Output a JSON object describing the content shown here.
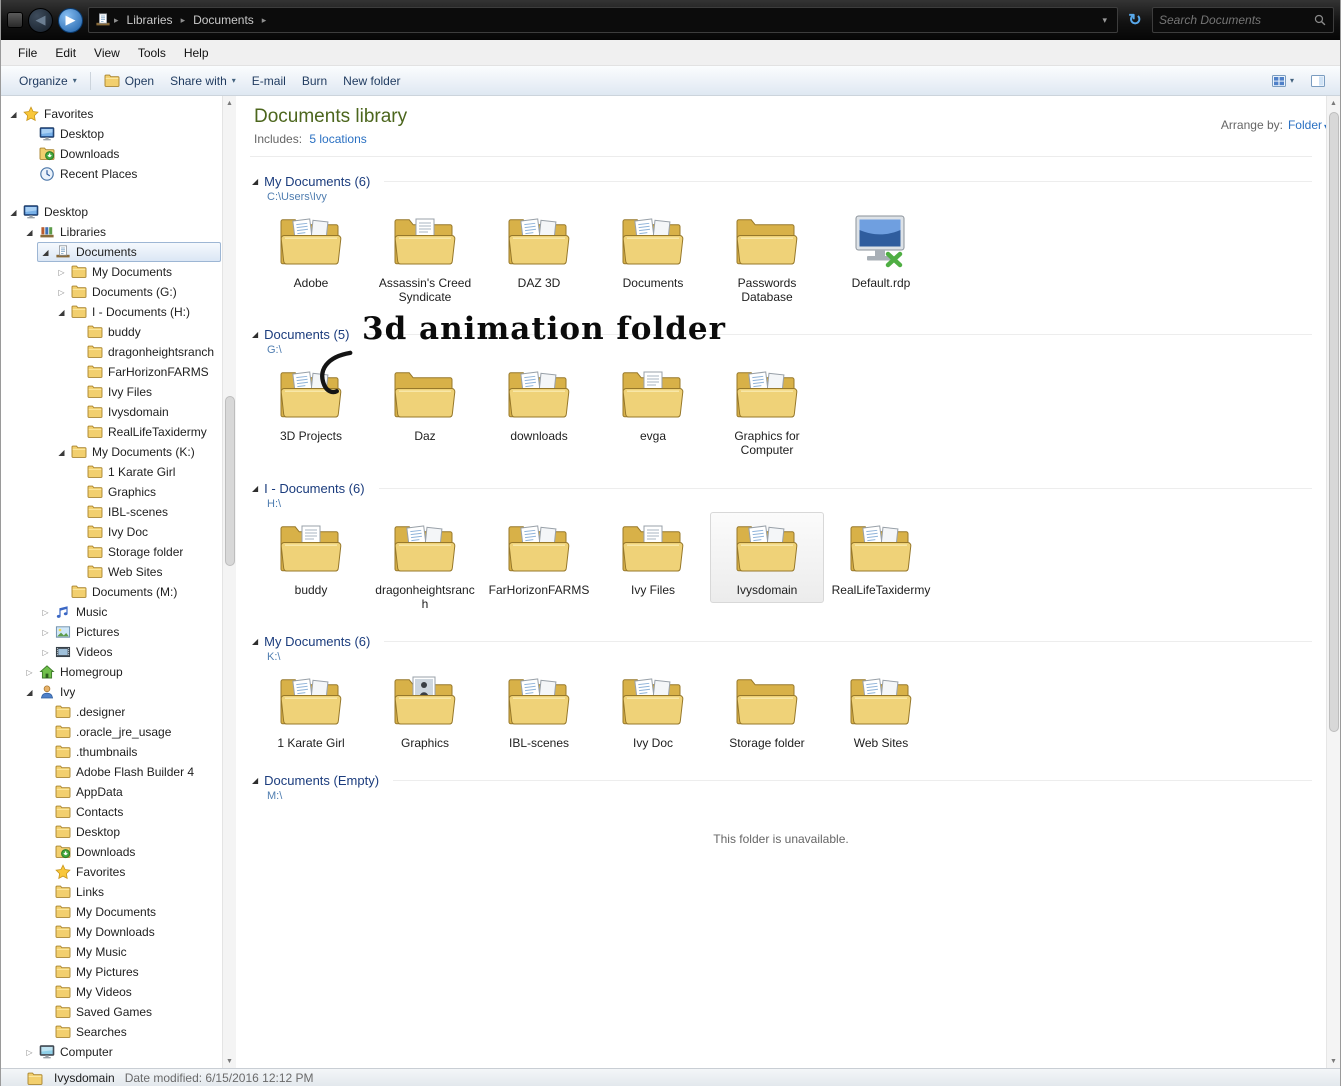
{
  "titlebar": {
    "breadcrumb_items": [
      "Libraries",
      "Documents"
    ],
    "search_placeholder": "Search Documents"
  },
  "menubar": {
    "items": [
      "File",
      "Edit",
      "View",
      "Tools",
      "Help"
    ]
  },
  "toolbar": {
    "organize": "Organize",
    "open": "Open",
    "share": "Share with",
    "email": "E-mail",
    "burn": "Burn",
    "new_folder": "New folder"
  },
  "sidebar": {
    "items": [
      {
        "label": "Favorites",
        "icon": "star",
        "level": 0,
        "expander": "expanded"
      },
      {
        "label": "Desktop",
        "icon": "monitor",
        "level": 1
      },
      {
        "label": "Downloads",
        "icon": "downloads",
        "level": 1
      },
      {
        "label": "Recent Places",
        "icon": "recent",
        "level": 1
      },
      {
        "label": "Desktop",
        "icon": "monitor",
        "level": 0,
        "expander": "expanded",
        "group_start": true
      },
      {
        "label": "Libraries",
        "icon": "library",
        "level": 1,
        "expander": "expanded"
      },
      {
        "label": "Documents",
        "icon": "doclib",
        "level": 2,
        "expander": "expanded",
        "selected": true
      },
      {
        "label": "My Documents",
        "icon": "folder",
        "level": 3,
        "expander": "collapsed"
      },
      {
        "label": "Documents (G:)",
        "icon": "folder",
        "level": 3,
        "expander": "collapsed"
      },
      {
        "label": "I - Documents (H:)",
        "icon": "folder",
        "level": 3,
        "expander": "expanded"
      },
      {
        "label": "buddy",
        "icon": "folder",
        "level": 4
      },
      {
        "label": "dragonheightsranch",
        "icon": "folder",
        "level": 4
      },
      {
        "label": "FarHorizonFARMS",
        "icon": "folder",
        "level": 4
      },
      {
        "label": "Ivy Files",
        "icon": "folder",
        "level": 4
      },
      {
        "label": "Ivysdomain",
        "icon": "folder",
        "level": 4
      },
      {
        "label": "RealLifeTaxidermy",
        "icon": "folder",
        "level": 4
      },
      {
        "label": "My Documents (K:)",
        "icon": "folder",
        "level": 3,
        "expander": "expanded"
      },
      {
        "label": "1 Karate Girl",
        "icon": "folder",
        "level": 4
      },
      {
        "label": "Graphics",
        "icon": "folder",
        "level": 4
      },
      {
        "label": "IBL-scenes",
        "icon": "folder",
        "level": 4
      },
      {
        "label": "Ivy Doc",
        "icon": "folder",
        "level": 4
      },
      {
        "label": "Storage folder",
        "icon": "folder",
        "level": 4
      },
      {
        "label": "Web Sites",
        "icon": "folder",
        "level": 4
      },
      {
        "label": "Documents (M:)",
        "icon": "folder",
        "level": 3
      },
      {
        "label": "Music",
        "icon": "music",
        "level": 2,
        "expander": "collapsed"
      },
      {
        "label": "Pictures",
        "icon": "pictures",
        "level": 2,
        "expander": "collapsed"
      },
      {
        "label": "Videos",
        "icon": "videos",
        "level": 2,
        "expander": "collapsed"
      },
      {
        "label": "Homegroup",
        "icon": "homegroup",
        "level": 1,
        "expander": "collapsed"
      },
      {
        "label": "Ivy",
        "icon": "user",
        "level": 1,
        "expander": "expanded"
      },
      {
        "label": ".designer",
        "icon": "folder",
        "level": 2
      },
      {
        "label": ".oracle_jre_usage",
        "icon": "folder",
        "level": 2
      },
      {
        "label": ".thumbnails",
        "icon": "folder",
        "level": 2
      },
      {
        "label": "Adobe Flash Builder 4",
        "icon": "folder",
        "level": 2
      },
      {
        "label": "AppData",
        "icon": "folder",
        "level": 2
      },
      {
        "label": "Contacts",
        "icon": "folder",
        "level": 2
      },
      {
        "label": "Desktop",
        "icon": "folder",
        "level": 2
      },
      {
        "label": "Downloads",
        "icon": "downloads",
        "level": 2
      },
      {
        "label": "Favorites",
        "icon": "star",
        "level": 2
      },
      {
        "label": "Links",
        "icon": "folder",
        "level": 2
      },
      {
        "label": "My Documents",
        "icon": "folder",
        "level": 2
      },
      {
        "label": "My Downloads",
        "icon": "folder",
        "level": 2
      },
      {
        "label": "My Music",
        "icon": "folder",
        "level": 2
      },
      {
        "label": "My Pictures",
        "icon": "folder",
        "level": 2
      },
      {
        "label": "My Videos",
        "icon": "folder",
        "level": 2
      },
      {
        "label": "Saved Games",
        "icon": "folder",
        "level": 2
      },
      {
        "label": "Searches",
        "icon": "folder",
        "level": 2
      },
      {
        "label": "Computer",
        "icon": "computer",
        "level": 1,
        "expander": "collapsed"
      }
    ]
  },
  "library": {
    "title": "Documents library",
    "includes_label": "Includes:",
    "includes_link": "5 locations",
    "arrange_label": "Arrange by:",
    "arrange_value": "Folder"
  },
  "annotation": {
    "text": "3d animation folder"
  },
  "sections": [
    {
      "name": "My Documents",
      "count": "(6)",
      "path": "C:\\Users\\Ivy",
      "items": [
        {
          "label": "Adobe",
          "icon": "folder-doc"
        },
        {
          "label": "Assassin's Creed Syndicate",
          "icon": "folder-paper"
        },
        {
          "label": "DAZ 3D",
          "icon": "folder-doc"
        },
        {
          "label": "Documents",
          "icon": "folder-doc"
        },
        {
          "label": "Passwords Database",
          "icon": "folder"
        },
        {
          "label": "Default.rdp",
          "icon": "rdp"
        }
      ]
    },
    {
      "name": "Documents",
      "count": "(5)",
      "path": "G:\\",
      "annotated": true,
      "items": [
        {
          "label": "3D Projects",
          "icon": "folder-doc"
        },
        {
          "label": "Daz",
          "icon": "folder"
        },
        {
          "label": "downloads",
          "icon": "folder-doc"
        },
        {
          "label": "evga",
          "icon": "folder-paper"
        },
        {
          "label": "Graphics for Computer",
          "icon": "folder-doc"
        }
      ]
    },
    {
      "name": "I - Documents",
      "count": "(6)",
      "path": "H:\\",
      "items": [
        {
          "label": "buddy",
          "icon": "folder-paper"
        },
        {
          "label": "dragonheightsranch",
          "icon": "folder-doc"
        },
        {
          "label": "FarHorizonFARMS",
          "icon": "folder-doc"
        },
        {
          "label": "Ivy Files",
          "icon": "folder-paper"
        },
        {
          "label": "Ivysdomain",
          "icon": "folder-doc",
          "selected": true
        },
        {
          "label": "RealLifeTaxidermy",
          "icon": "folder-doc"
        }
      ]
    },
    {
      "name": "My Documents",
      "count": "(6)",
      "path": "K:\\",
      "items": [
        {
          "label": "1 Karate Girl",
          "icon": "folder-doc"
        },
        {
          "label": "Graphics",
          "icon": "folder-photo"
        },
        {
          "label": "IBL-scenes",
          "icon": "folder-doc"
        },
        {
          "label": "Ivy Doc",
          "icon": "folder-doc"
        },
        {
          "label": "Storage folder",
          "icon": "folder"
        },
        {
          "label": "Web Sites",
          "icon": "folder-doc"
        }
      ]
    },
    {
      "name": "Documents",
      "count": "(Empty)",
      "path": "M:\\",
      "empty_message": "This folder is unavailable.",
      "items": []
    }
  ],
  "statusbar": {
    "file_name": "Ivysdomain",
    "detail_label": "Date modified:",
    "detail_value": "6/15/2016 12:12 PM"
  }
}
